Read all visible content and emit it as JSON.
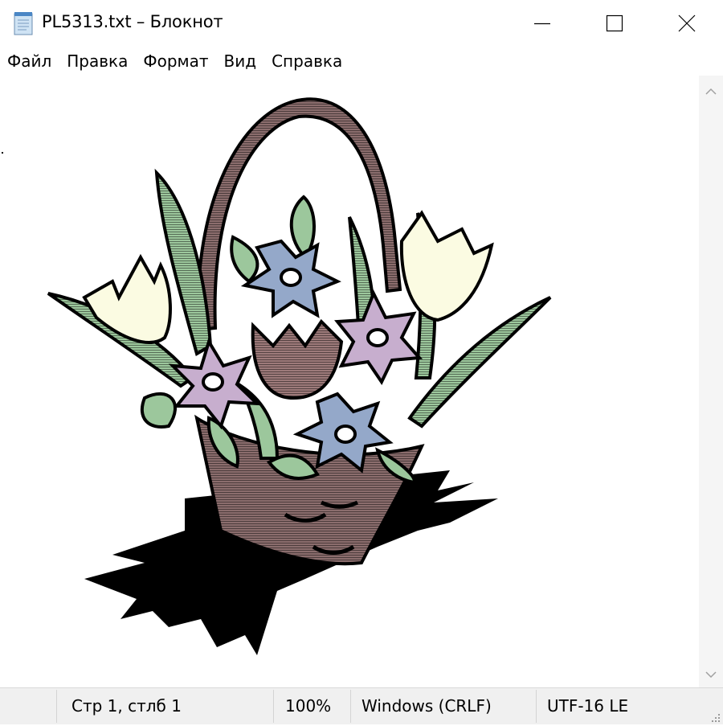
{
  "window": {
    "title": "PL5313.txt – Блокнот",
    "icon": "notepad-icon",
    "controls": {
      "minimize": "minimize-icon",
      "maximize": "maximize-icon",
      "close": "close-icon"
    }
  },
  "menu": [
    "Файл",
    "Правка",
    "Формат",
    "Вид",
    "Справка"
  ],
  "document": {
    "content_description": "flower-basket-ascii-art",
    "colors": {
      "basket": "#8b6d6d",
      "leaf": "#9cc79c",
      "tulip_cream": "#fbfbe2",
      "flower_blue": "#94a8c9",
      "flower_lilac": "#c7aece",
      "tulip_mauve": "#9d7a7a",
      "shadow": "#000000"
    }
  },
  "status": {
    "position": "Стр 1, стлб 1",
    "zoom": "100%",
    "line_endings": "Windows (CRLF)",
    "encoding": "UTF-16 LE"
  }
}
